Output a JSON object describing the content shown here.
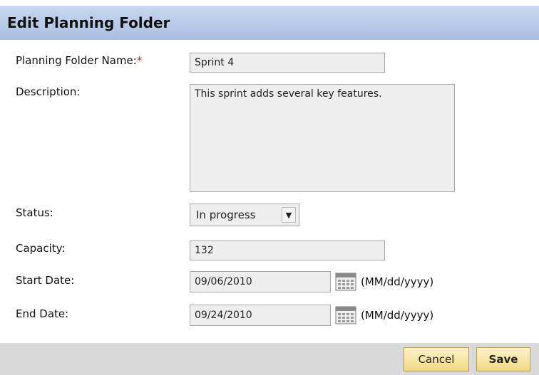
{
  "dialog": {
    "title": "Edit Planning Folder"
  },
  "fields": {
    "name": {
      "label": "Planning Folder Name:",
      "required_mark": "*",
      "value": "Sprint 4"
    },
    "description": {
      "label": "Description:",
      "value": "This sprint adds several key features."
    },
    "status": {
      "label": "Status:",
      "value": "In progress"
    },
    "capacity": {
      "label": "Capacity:",
      "value": "132"
    },
    "start_date": {
      "label": "Start Date:",
      "value": "09/06/2010",
      "format": "(MM/dd/yyyy)"
    },
    "end_date": {
      "label": "End Date:",
      "value": "09/24/2010",
      "format": "(MM/dd/yyyy)"
    }
  },
  "buttons": {
    "cancel": "Cancel",
    "save": "Save"
  },
  "colors": {
    "header": "#b8cbea",
    "footer": "#d9d9d9",
    "button": "#f3df95",
    "required": "#d31f1f"
  }
}
